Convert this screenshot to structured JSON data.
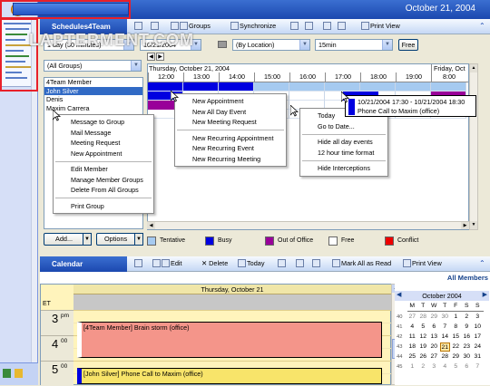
{
  "date_header": "October 21, 2004",
  "watermark": "LAPTERMENT.COM",
  "toolbar": {
    "pane_title": "Schedules4Team",
    "groups": "Groups",
    "synchronize": "Synchronize",
    "print_view": "Print View"
  },
  "filters": {
    "interval": "1 day (30 minutes)",
    "date": "10/21/2004",
    "location": "(By Location)",
    "timescale": "15min",
    "free_button": "Free",
    "group": "(All Groups)"
  },
  "members": [
    "4Team Member",
    "John Silver",
    "Denis",
    "Maxim Carrera"
  ],
  "selected_member_index": 1,
  "grid": {
    "date_label": "Thursday, October 21, 2004",
    "next_date_label": "Friday, Oct",
    "hours": [
      "12:00",
      "13:00",
      "14:00",
      "15:00",
      "16:00",
      "17:00",
      "18:00",
      "19:00",
      "8:00"
    ]
  },
  "member_menu": [
    "Message to Group",
    "Mail Message",
    "Meeting Request",
    "New Appointment",
    "-",
    "Edit Member",
    "Manage Member Groups",
    "Delete From All Groups",
    "-",
    "Print Group"
  ],
  "grid_menu": [
    "New Appointment",
    "New All Day Event",
    "New Meeting Request",
    "-",
    "New Recurring Appointment",
    "New Recurring Event",
    "New Recurring Meeting"
  ],
  "view_menu": [
    "Today",
    "Go to Date...",
    "-",
    "Hide all day events",
    "12 hour time format",
    "-",
    "Hide Interceptions"
  ],
  "tooltip": {
    "time": "10/21/2004 17:30 - 10/21/2004 18:30",
    "subject": "Phone Call to Maxim (office)"
  },
  "bottom_buttons": {
    "add": "Add...",
    "options": "Options"
  },
  "legend": [
    {
      "label": "Tentative",
      "color": "#A6CAF0"
    },
    {
      "label": "Busy",
      "color": "#0000E0"
    },
    {
      "label": "Out of Office",
      "color": "#990099"
    },
    {
      "label": "Free",
      "color": "#FFFFFF"
    },
    {
      "label": "Conflict",
      "color": "#EE0000"
    }
  ],
  "calendar": {
    "title": "Calendar",
    "toolbar": {
      "edit": "Edit",
      "delete": "Delete",
      "today": "Today",
      "mark_all_read": "Mark All as Read",
      "print_view": "Print View"
    },
    "all_members": "All Members",
    "day_header": "Thursday, October 21",
    "tz": "ET",
    "hours": [
      {
        "h": "3",
        "ampm": "pm"
      },
      {
        "h": "4",
        "ampm": "00"
      },
      {
        "h": "5",
        "ampm": "00"
      }
    ],
    "events": [
      {
        "text": "[4Team Member] Brain storm (office)",
        "color": "#F4958A"
      },
      {
        "text": "[John Silver] Phone Call to Maxim (office)",
        "color": "#F8E46A"
      }
    ]
  },
  "mini_cal": {
    "month": "October 2004",
    "dow": [
      "M",
      "T",
      "W",
      "T",
      "F",
      "S",
      "S"
    ],
    "weeks": [
      {
        "wk": "40",
        "days": [
          "27",
          "28",
          "29",
          "30",
          "1",
          "2",
          "3"
        ]
      },
      {
        "wk": "41",
        "days": [
          "4",
          "5",
          "6",
          "7",
          "8",
          "9",
          "10"
        ]
      },
      {
        "wk": "42",
        "days": [
          "11",
          "12",
          "13",
          "14",
          "15",
          "16",
          "17"
        ]
      },
      {
        "wk": "43",
        "days": [
          "18",
          "19",
          "20",
          "21",
          "22",
          "23",
          "24"
        ]
      },
      {
        "wk": "44",
        "days": [
          "25",
          "26",
          "27",
          "28",
          "29",
          "30",
          "31"
        ]
      },
      {
        "wk": "45",
        "days": [
          "1",
          "2",
          "3",
          "4",
          "5",
          "6",
          "7"
        ]
      }
    ],
    "today": "21"
  }
}
